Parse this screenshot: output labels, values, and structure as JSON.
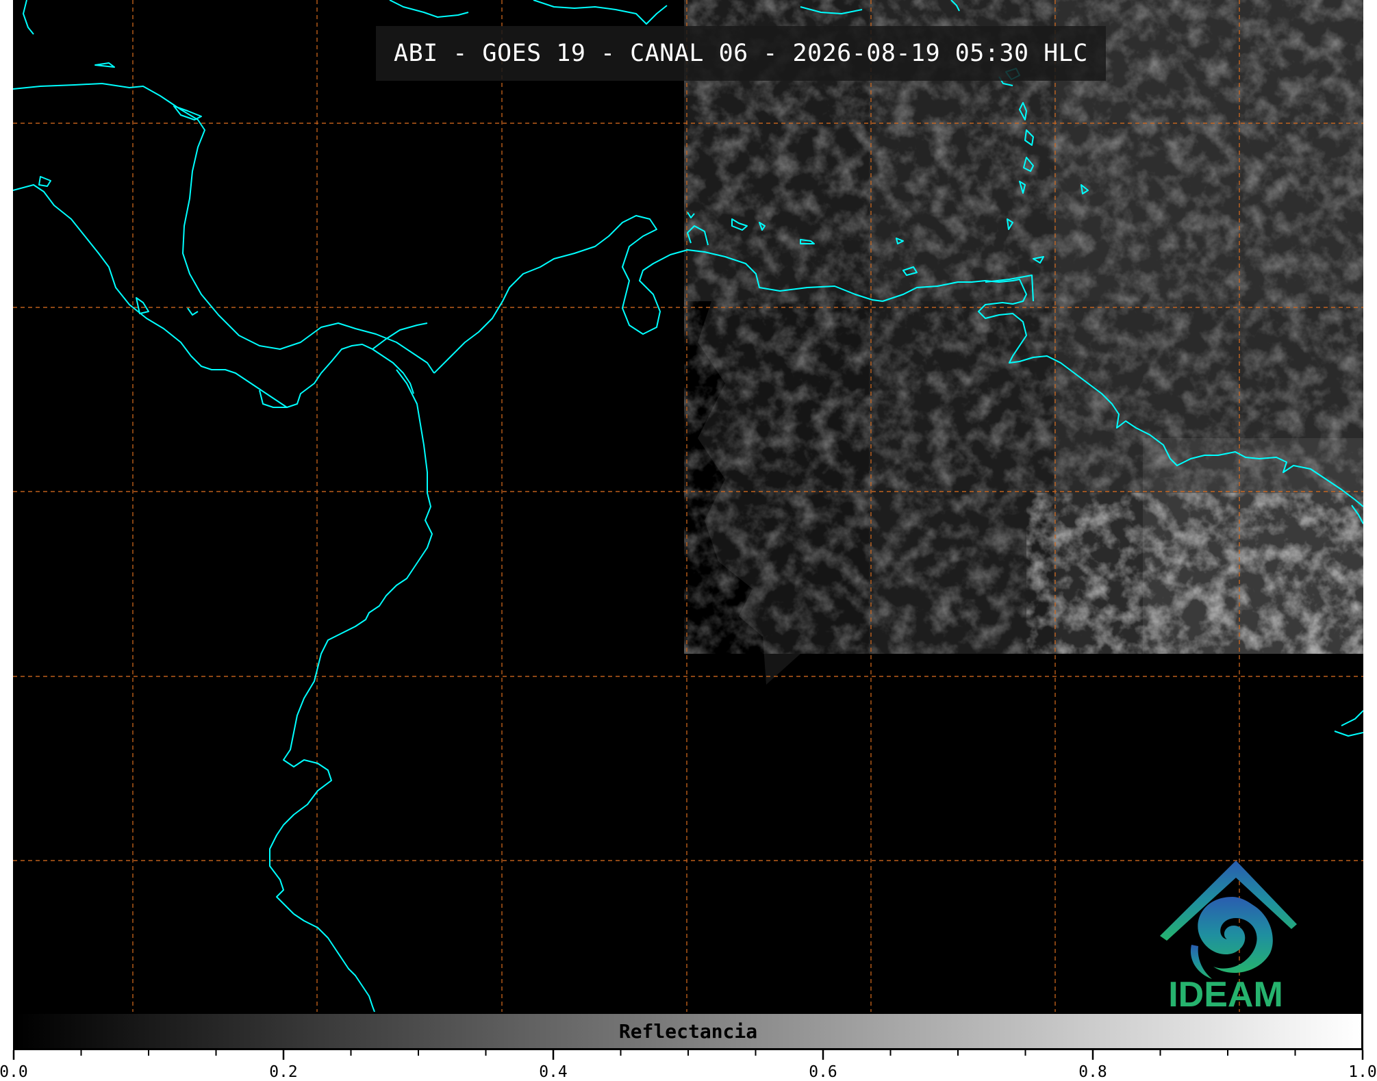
{
  "title": "ABI - GOES 19 - CANAL 06 - 2026-08-19 05:30 HLC",
  "logo": {
    "text": "IDEAM",
    "icon": "ideam-logo-icon"
  },
  "colorbar": {
    "label": "Reflectancia",
    "range": [
      0.0,
      1.0
    ],
    "tick_labels": [
      "0.0",
      "0.2",
      "0.4",
      "0.6",
      "0.8",
      "1.0"
    ],
    "colors": {
      "start": "#000000",
      "end": "#ffffff"
    }
  },
  "map": {
    "coastline_color": "#00ffff",
    "grid_color": "#d2691e",
    "grid_style": "dashed",
    "background": "#000000"
  }
}
